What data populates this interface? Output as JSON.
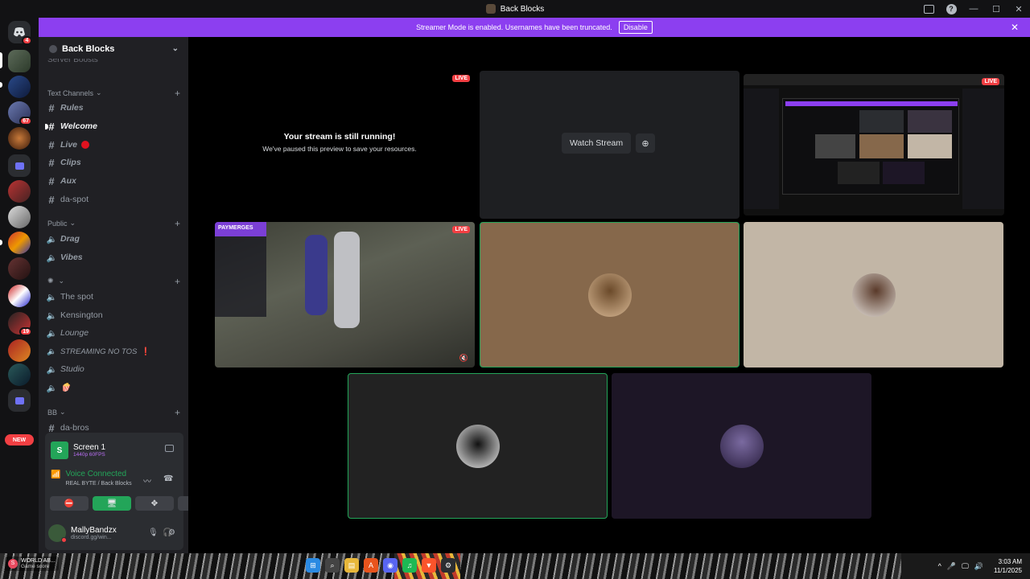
{
  "window": {
    "title": "Back Blocks"
  },
  "banner": {
    "text": "Streamer Mode is enabled. Usernames have been truncated.",
    "disable_label": "Disable",
    "color": "#8c3ff0"
  },
  "guilds": {
    "badges": {
      "home": "4",
      "server3": "67",
      "server10": "19"
    },
    "new_label": "NEW"
  },
  "sidebar": {
    "server_name": "Back Blocks",
    "boosts_label": "Server Boosts",
    "categories": {
      "text_channels": "Text Channels",
      "public": "Public",
      "unnamed": "",
      "bb": "BB"
    },
    "channels": {
      "rules": "Rules",
      "welcome": "Welcome",
      "live": "Live",
      "clips": "Clips",
      "aux": "Aux",
      "da_spot": "da-spot",
      "drag": "Drag",
      "vibes": "Vibes",
      "the_spot": "The spot",
      "kensington": "Kensington",
      "lounge": "Lounge",
      "streaming": "STREAMING NO TOS",
      "studio": "Studio",
      "da_bros": "da-bros"
    }
  },
  "panel": {
    "screen_title": "Screen 1",
    "screen_quality": "1440p 60FPS",
    "voice_status": "Voice Connected",
    "voice_location": "REAL BYTE / Back Blocks",
    "user_name": "MallyBandzx",
    "user_status": "discord.gg/win..."
  },
  "stream": {
    "live_label": "LIVE",
    "paused_title": "Your stream is still running!",
    "paused_sub": "We've paused this preview to save your resources.",
    "watch_label": "Watch Stream",
    "game_tag": "PAYMERGES"
  },
  "taskbar": {
    "news_title": "WORLD AB...",
    "news_sub": "Game score",
    "time": "3:03 AM",
    "date": "11/1/2025"
  },
  "colors": {
    "accent_green": "#23a559",
    "live_red": "#f23f43",
    "tile_brown": "#86684b",
    "tile_beige": "#c2b6a6",
    "tile_purple": "#1d1626"
  }
}
